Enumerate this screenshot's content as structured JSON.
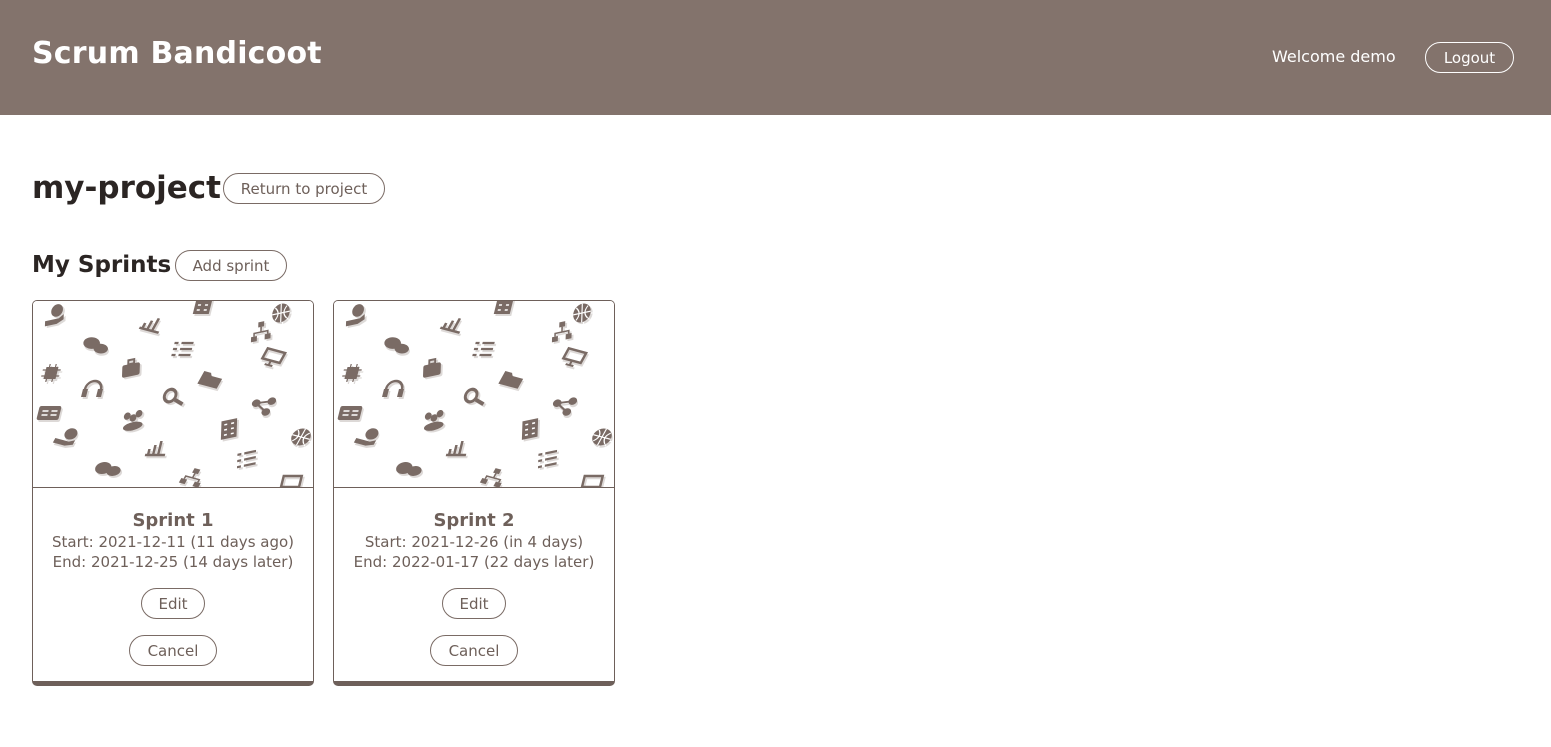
{
  "header": {
    "brand": "Scrum Bandicoot",
    "welcome": "Welcome demo",
    "logout_label": "Logout"
  },
  "project": {
    "name": "my-project",
    "return_label": "Return to project"
  },
  "sprints_section": {
    "title": "My Sprints",
    "add_label": "Add sprint"
  },
  "sprints": [
    {
      "name": "Sprint 1",
      "start": "Start: 2021-12-11 (11 days ago)",
      "end": "End: 2021-12-25 (14 days later)",
      "edit_label": "Edit",
      "cancel_label": "Cancel"
    },
    {
      "name": "Sprint 2",
      "start": "Start: 2021-12-26 (in 4 days)",
      "end": "End: 2022-01-17 (22 days later)",
      "edit_label": "Edit",
      "cancel_label": "Cancel"
    }
  ],
  "colors": {
    "header_bg": "#83736c",
    "accent": "#6e605a",
    "icon_fill": "#7a6b65"
  },
  "card_image_icons": [
    "hand-coin-icon",
    "bar-chart-icon",
    "building-icon",
    "globe-icon",
    "chat-bubbles-icon",
    "checklist-icon",
    "network-icon",
    "presentation-icon",
    "chip-icon",
    "briefcase-icon",
    "folder-icon",
    "headset-icon",
    "search-icon",
    "share-icon",
    "id-card-icon",
    "team-icon"
  ]
}
